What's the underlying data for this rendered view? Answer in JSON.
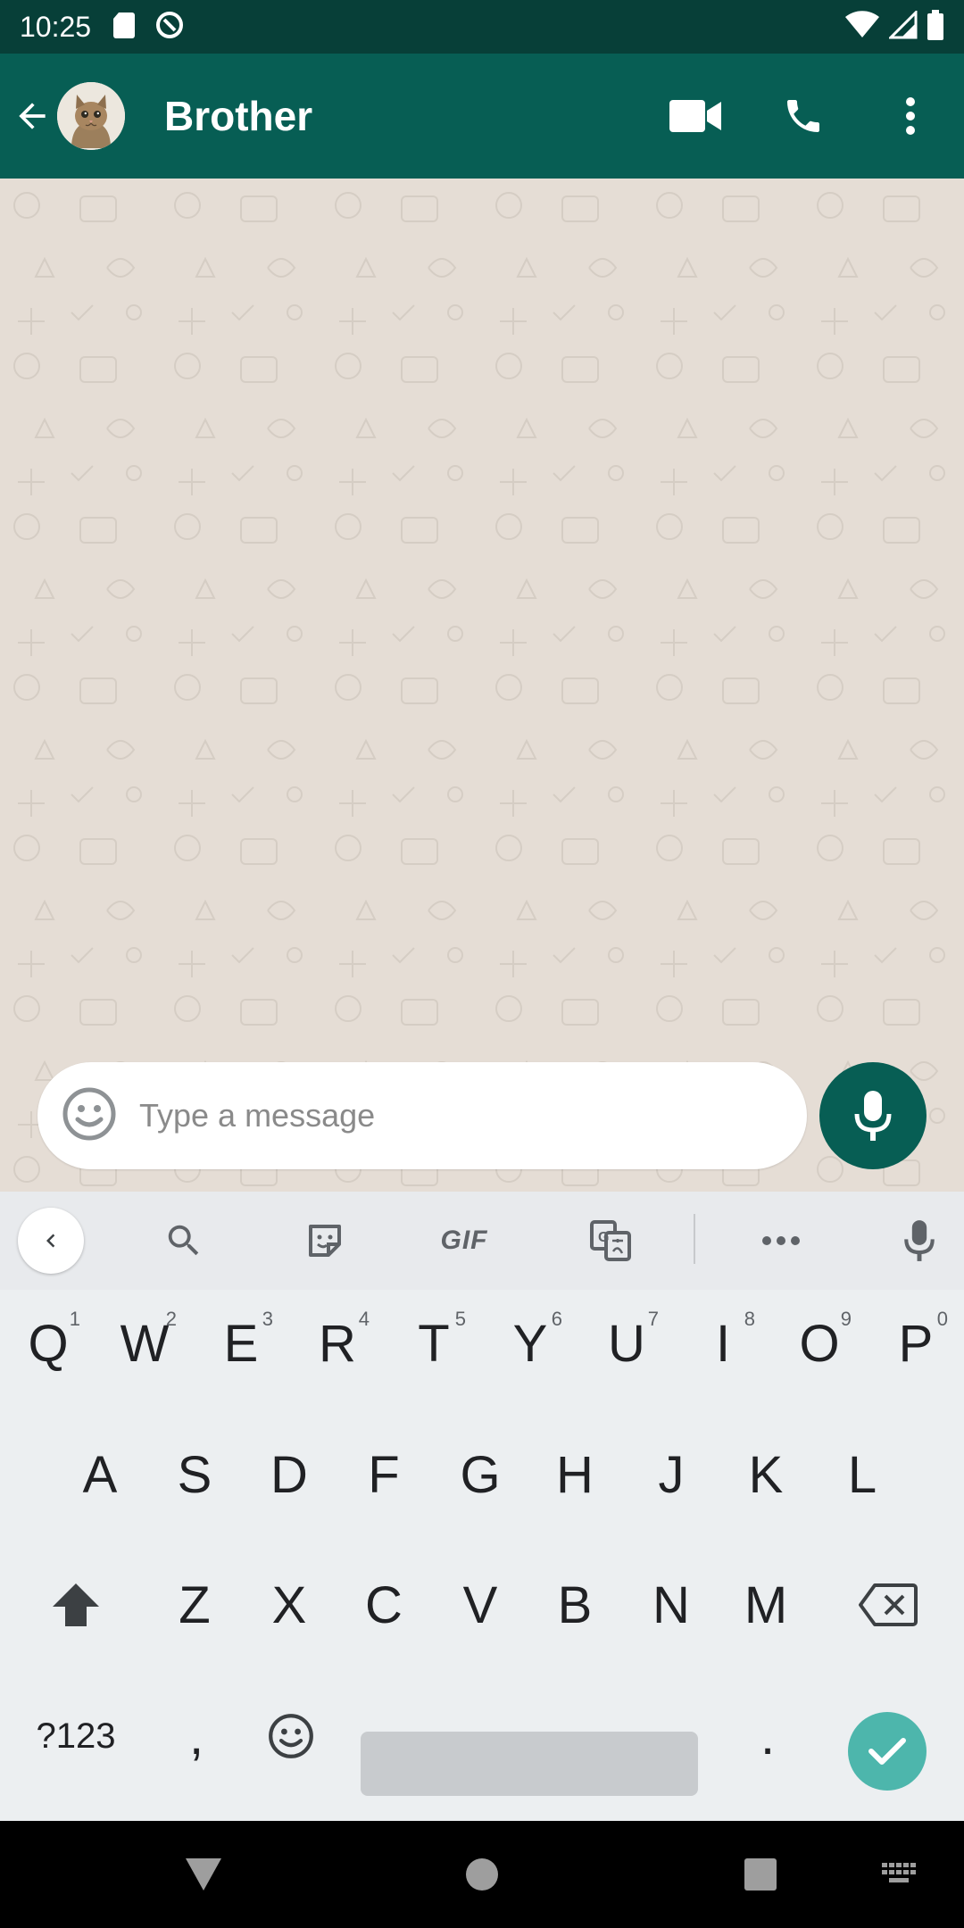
{
  "status_bar": {
    "time": "10:25"
  },
  "chat_header": {
    "contact_name": "Brother"
  },
  "composer": {
    "placeholder": "Type a message",
    "value": ""
  },
  "keyboard": {
    "toolbar": {
      "gif_label": "GIF"
    },
    "rows": {
      "row1": [
        {
          "letter": "Q",
          "hint": "1"
        },
        {
          "letter": "W",
          "hint": "2"
        },
        {
          "letter": "E",
          "hint": "3"
        },
        {
          "letter": "R",
          "hint": "4"
        },
        {
          "letter": "T",
          "hint": "5"
        },
        {
          "letter": "Y",
          "hint": "6"
        },
        {
          "letter": "U",
          "hint": "7"
        },
        {
          "letter": "I",
          "hint": "8"
        },
        {
          "letter": "O",
          "hint": "9"
        },
        {
          "letter": "P",
          "hint": "0"
        }
      ],
      "row2": [
        "A",
        "S",
        "D",
        "F",
        "G",
        "H",
        "J",
        "K",
        "L"
      ],
      "row3": [
        "Z",
        "X",
        "C",
        "V",
        "B",
        "N",
        "M"
      ]
    },
    "symbols_label": "?123",
    "comma_label": ",",
    "period_label": "."
  },
  "colors": {
    "header": "#075e54",
    "status_bar": "#073f38",
    "chat_background": "#e5ddd5",
    "enter_key": "#4db6ac"
  }
}
